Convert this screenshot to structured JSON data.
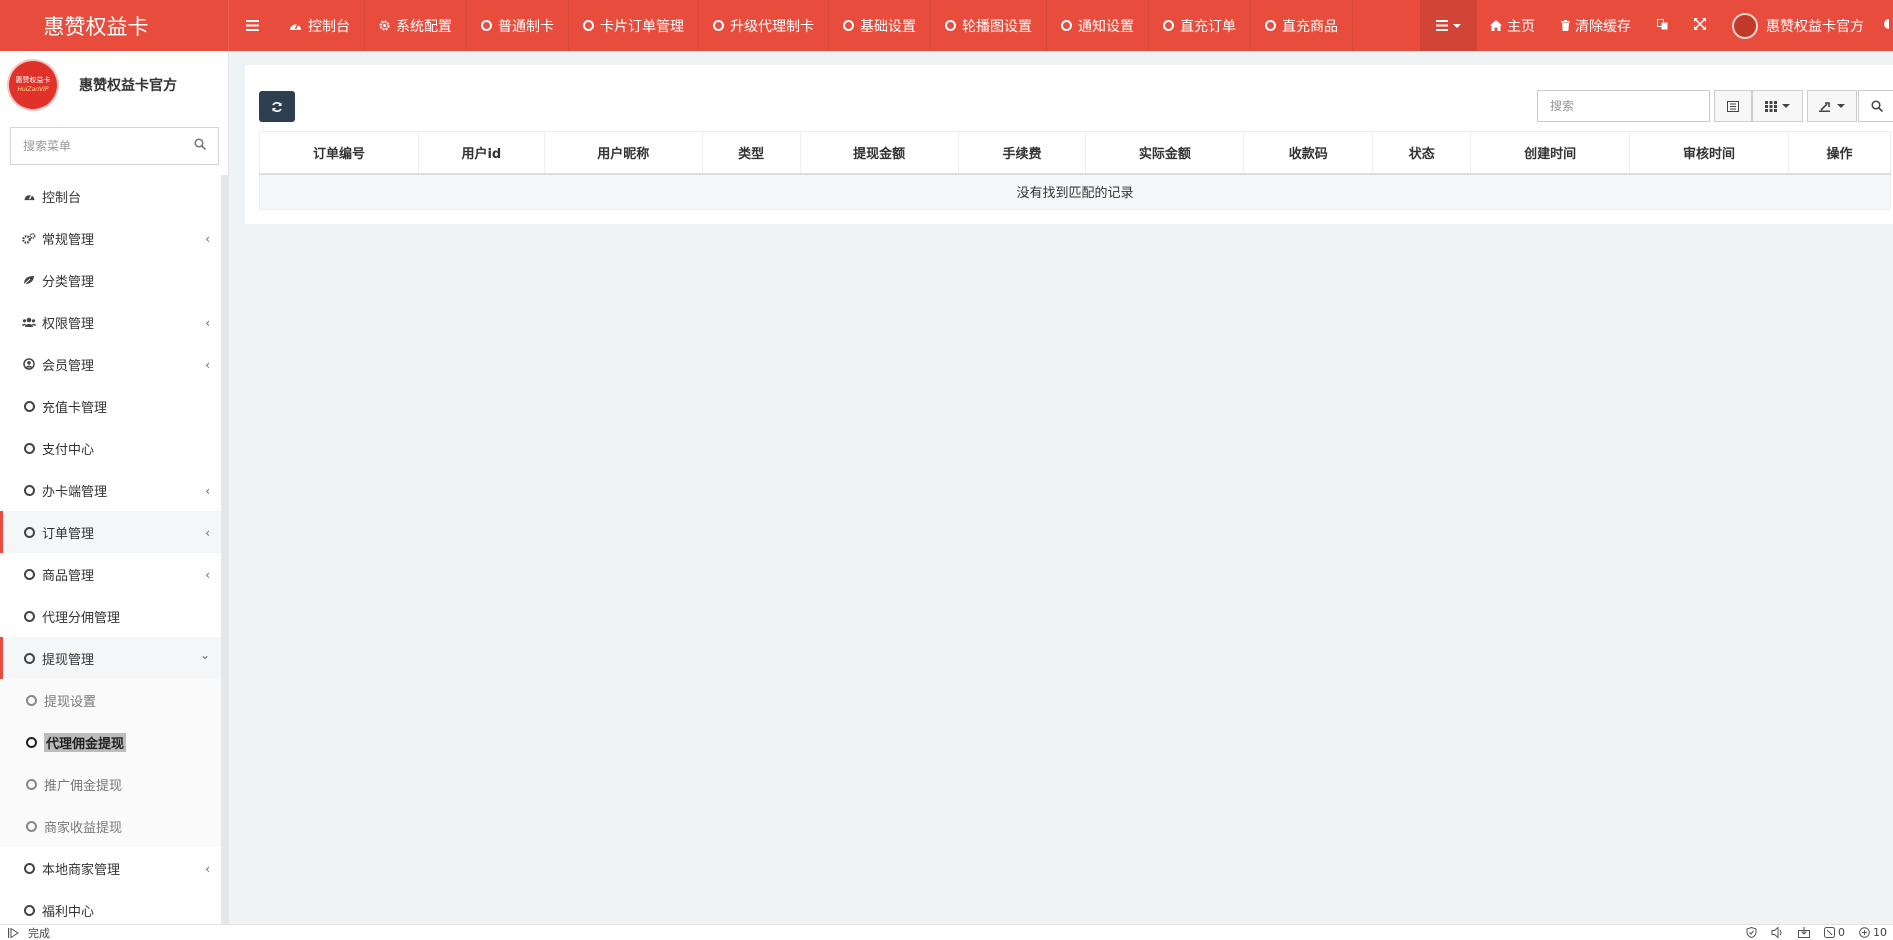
{
  "brand": {
    "title": "惠赞权益卡"
  },
  "topnav": [
    {
      "label": "控制台",
      "icon": "dashboard-icon"
    },
    {
      "label": "系统配置",
      "icon": "cog-icon"
    },
    {
      "label": "普通制卡",
      "icon": "circle-icon"
    },
    {
      "label": "卡片订单管理",
      "icon": "circle-icon"
    },
    {
      "label": "升级代理制卡",
      "icon": "circle-icon"
    },
    {
      "label": "基础设置",
      "icon": "circle-icon"
    },
    {
      "label": "轮播图设置",
      "icon": "circle-icon"
    },
    {
      "label": "通知设置",
      "icon": "circle-icon"
    },
    {
      "label": "直充订单",
      "icon": "circle-icon"
    },
    {
      "label": "直充商品",
      "icon": "circle-icon"
    }
  ],
  "topright": {
    "home_label": "主页",
    "clear_cache_label": "清除缓存",
    "user_name": "惠赞权益卡官方"
  },
  "sidebar": {
    "logo_line1": "惠赞权益卡",
    "logo_line2": "HuiZanVIP",
    "user_name": "惠赞权益卡官方",
    "search_placeholder": "搜索菜单",
    "items": [
      {
        "label": "控制台",
        "icon": "dashboard-icon"
      },
      {
        "label": "常规管理",
        "icon": "cogs-icon",
        "chevron": "‹"
      },
      {
        "label": "分类管理",
        "icon": "leaf-icon"
      },
      {
        "label": "权限管理",
        "icon": "group-icon",
        "chevron": "‹"
      },
      {
        "label": "会员管理",
        "icon": "user-circle-icon",
        "chevron": "‹"
      },
      {
        "label": "充值卡管理",
        "icon": "circle-icon"
      },
      {
        "label": "支付中心",
        "icon": "circle-icon"
      },
      {
        "label": "办卡端管理",
        "icon": "circle-icon",
        "chevron": "‹"
      },
      {
        "label": "订单管理",
        "icon": "circle-icon",
        "chevron": "‹"
      },
      {
        "label": "商品管理",
        "icon": "circle-icon",
        "chevron": "‹"
      },
      {
        "label": "代理分佣管理",
        "icon": "circle-icon"
      },
      {
        "label": "提现管理",
        "icon": "circle-icon",
        "chevron": "⌄"
      },
      {
        "label": "提现设置",
        "icon": "circle-icon"
      },
      {
        "label": "代理佣金提现",
        "icon": "circle-icon"
      },
      {
        "label": "推广佣金提现",
        "icon": "circle-icon"
      },
      {
        "label": "商家收益提现",
        "icon": "circle-icon"
      },
      {
        "label": "本地商家管理",
        "icon": "circle-icon",
        "chevron": "‹"
      },
      {
        "label": "福利中心",
        "icon": "circle-icon"
      }
    ]
  },
  "toolbar": {
    "search_placeholder": "搜索"
  },
  "table": {
    "columns": [
      "订单编号",
      "用户id",
      "用户昵称",
      "类型",
      "提现金额",
      "手续费",
      "实际金额",
      "收款码",
      "状态",
      "创建时间",
      "审核时间",
      "操作"
    ],
    "empty_text": "没有找到匹配的记录"
  },
  "statusbar": {
    "status_text": "完成",
    "count_a": "0",
    "zoom_text": "10"
  }
}
